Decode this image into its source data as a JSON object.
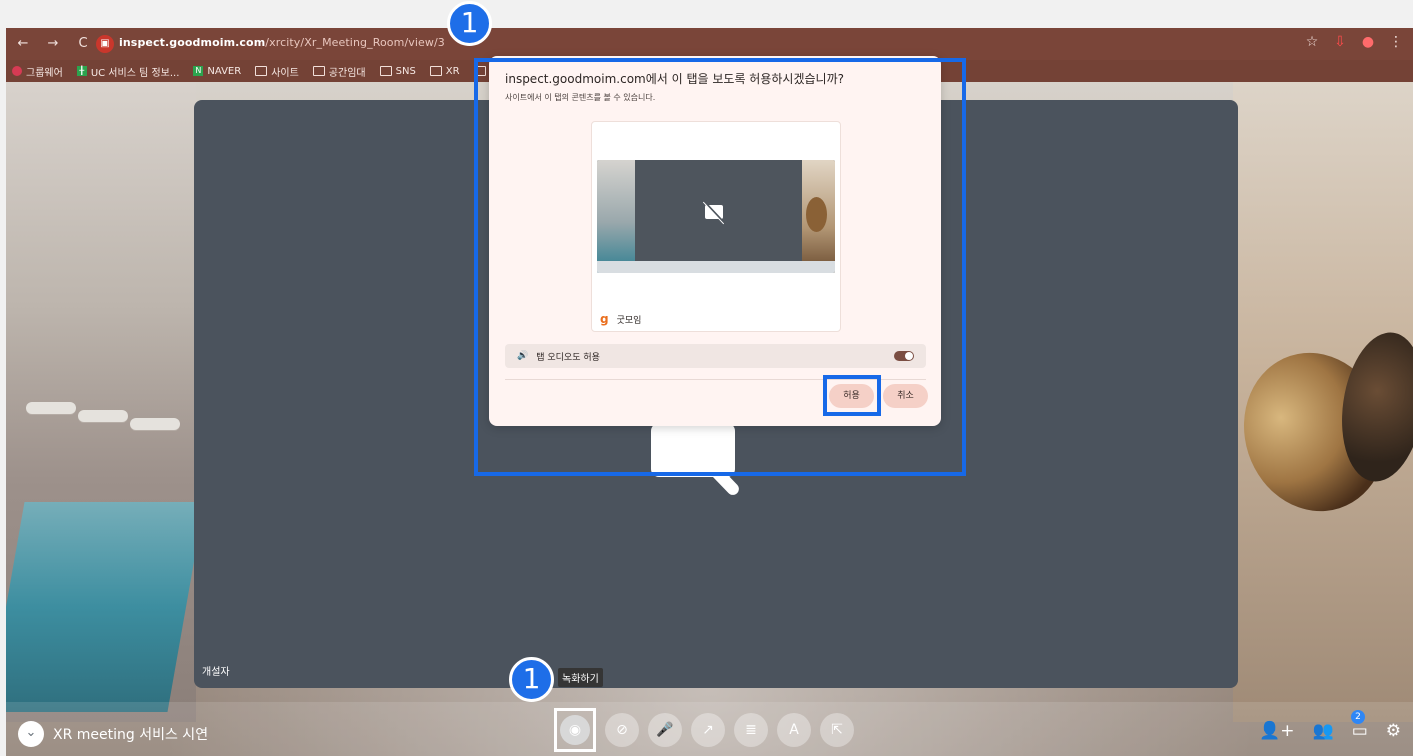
{
  "browser": {
    "url_host": "inspect.goodmoim.com",
    "url_path": "/xrcity/Xr_Meeting_Room/view/3",
    "tab_icon": "screen-share-icon",
    "bookmarks": [
      {
        "icon": "red-icon",
        "label": "그룹웨어"
      },
      {
        "icon": "green-icon",
        "label": "UC 서비스 팀 정보..."
      },
      {
        "icon": "green-icon",
        "label": "NAVER"
      },
      {
        "icon": "folder-icon",
        "label": "사이트"
      },
      {
        "icon": "folder-icon",
        "label": "공간임대"
      },
      {
        "icon": "folder-icon",
        "label": "SNS"
      },
      {
        "icon": "folder-icon",
        "label": "XR"
      },
      {
        "icon": "folder-icon",
        "label": "기"
      }
    ]
  },
  "meeting": {
    "host_label": "개설자",
    "title": "XR meeting 서비스 시연",
    "tooltip": "녹화하기",
    "badge_count": "2",
    "toolbar": [
      {
        "name": "record-button",
        "icon": "record-icon"
      },
      {
        "name": "camera-off-button",
        "icon": "camera-off-icon"
      },
      {
        "name": "mic-off-button",
        "icon": "mic-off-icon"
      },
      {
        "name": "share-screen-button",
        "icon": "share-icon"
      },
      {
        "name": "notes-button",
        "icon": "notes-icon"
      },
      {
        "name": "translate-button",
        "icon": "translate-icon"
      },
      {
        "name": "exit-button",
        "icon": "exit-icon"
      }
    ]
  },
  "dialog": {
    "title": "inspect.goodmoim.com에서 이 탭을 보도록 허용하시겠습니까?",
    "subtitle": "사이트에서 이 탭의 콘텐츠를 볼 수 있습니다.",
    "preview_label": "굿모임",
    "audio_label": "탭 오디오도 허용",
    "allow_label": "허용",
    "cancel_label": "취소"
  },
  "annotations": {
    "top_marker": "1",
    "bottom_marker": "1"
  },
  "colors": {
    "highlight": "#1769e8",
    "browser_chrome": "#7a4539",
    "meeting_panel": "#4b535d"
  }
}
